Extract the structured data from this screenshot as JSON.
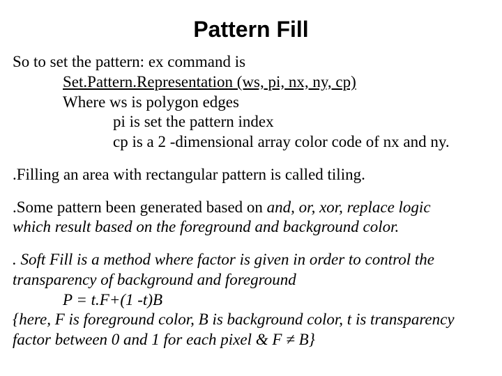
{
  "title": "Pattern Fill",
  "lines": {
    "l1": "So to set the pattern: ex command is",
    "l2a": "Set.Pattern.Representation  (ws, pi, nx, ny, cp)",
    "l3": "Where ws is polygon edges",
    "l4": "pi is set the pattern index",
    "l5": "cp is a 2 -dimensional array color code of nx and ny.",
    "l6": ".Filling an area with rectangular pattern is called tiling.",
    "l7a": ".Some pattern been generated based on ",
    "l7b": "and, or, xor, replace logic",
    "l8": "which result based on the foreground and background color.",
    "l9a": ". ",
    "l9b": "Soft Fill is a method where factor is given in order to control the",
    "l10": "transparency of background and foreground",
    "l11": "P = t.F+(1 -t)B",
    "l12": "{here, F is foreground color, B is background color, t is transparency",
    "l13": "factor between 0 and 1 for each pixel & F ≠ B}"
  }
}
